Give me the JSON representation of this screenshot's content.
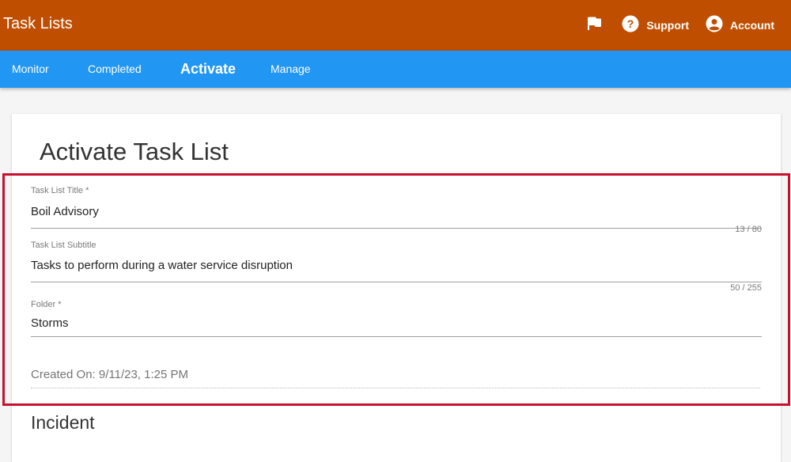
{
  "header": {
    "title": "Task Lists",
    "flag_icon": "flag-icon",
    "support": {
      "label": "Support",
      "icon": "help-circle-icon"
    },
    "account": {
      "label": "Account",
      "icon": "account-circle-icon"
    }
  },
  "nav": {
    "tabs": [
      {
        "label": "Monitor"
      },
      {
        "label": "Completed"
      },
      {
        "label": "Activate",
        "active": true
      },
      {
        "label": "Manage"
      }
    ]
  },
  "page": {
    "title": "Activate Task List",
    "fields": {
      "title": {
        "label": "Task List Title *",
        "value": "Boil Advisory",
        "counter": "13 / 80"
      },
      "subtitle": {
        "label": "Task List Subtitle",
        "value": "Tasks to perform during a water service disruption",
        "counter": "50 / 255"
      },
      "folder": {
        "label": "Folder *",
        "value": "Storms"
      }
    },
    "created_on": "Created On: 9/11/23, 1:25 PM",
    "section_title": "Incident"
  },
  "colors": {
    "header_bg": "#c04e00",
    "nav_bg": "#2196f3",
    "highlight_border": "#c8102e"
  }
}
